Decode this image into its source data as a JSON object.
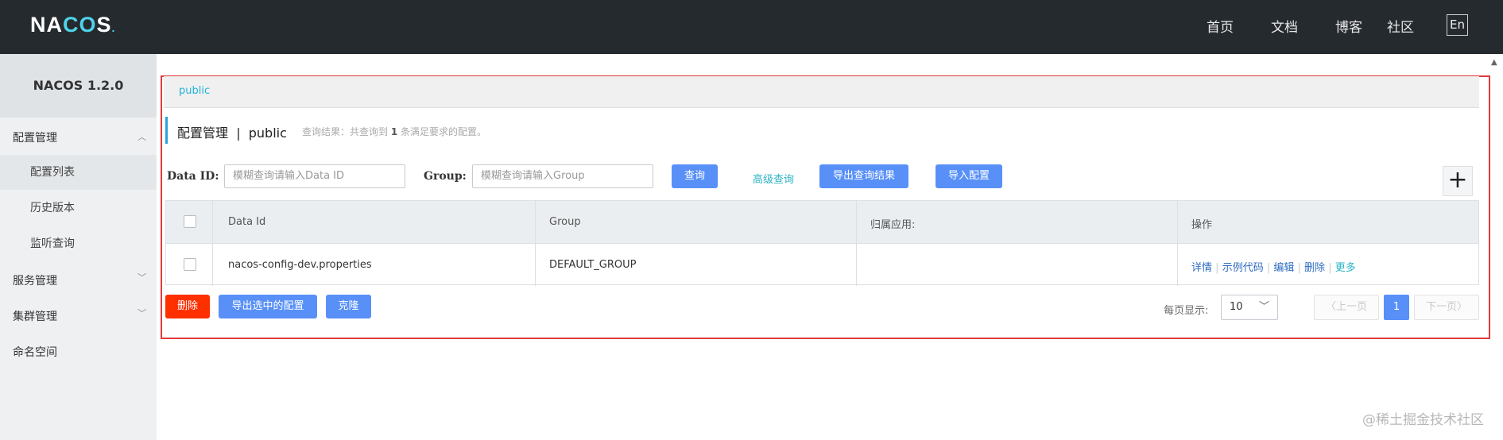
{
  "header": {
    "logo_prefix": "NA",
    "logo_accent": "CO",
    "logo_suffix": "S",
    "logo_dot": ".",
    "nav": [
      "首页",
      "文档",
      "博客",
      "社区"
    ],
    "lang": "En"
  },
  "sidebar": {
    "version": "NACOS 1.2.0",
    "config_mgmt": "配置管理",
    "config_sub": [
      "配置列表",
      "历史版本",
      "监听查询"
    ],
    "service_mgmt": "服务管理",
    "cluster_mgmt": "集群管理",
    "namespace": "命名空间"
  },
  "breadcrumb": {
    "namespace": "public"
  },
  "page": {
    "title_main": "配置管理",
    "title_sep": "|",
    "title_ns": "public",
    "result_prefix": "查询结果：共查询到",
    "result_count": "1",
    "result_suffix": "条满足要求的配置。"
  },
  "search": {
    "dataid_label": "Data ID:",
    "dataid_placeholder": "模糊查询请输入Data ID",
    "group_label": "Group:",
    "group_placeholder": "模糊查询请输入Group",
    "query_btn": "查询",
    "advanced": "高级查询",
    "export_result": "导出查询结果",
    "import_config": "导入配置",
    "add": "+"
  },
  "table": {
    "columns": [
      "Data Id",
      "Group",
      "归属应用:",
      "操作"
    ],
    "rows": [
      {
        "data_id": "nacos-config-dev.properties",
        "group": "DEFAULT_GROUP",
        "app": ""
      }
    ],
    "ops": [
      "详情",
      "示例代码",
      "编辑",
      "删除",
      "更多"
    ],
    "sep": "|"
  },
  "bulk": {
    "delete": "删除",
    "export_selected": "导出选中的配置",
    "clone": "克隆"
  },
  "pagination": {
    "per_page_label": "每页显示:",
    "per_page": "10",
    "prev": "上一页",
    "next": "下一页",
    "current": "1"
  },
  "watermark": "@稀土掘金技术社区"
}
